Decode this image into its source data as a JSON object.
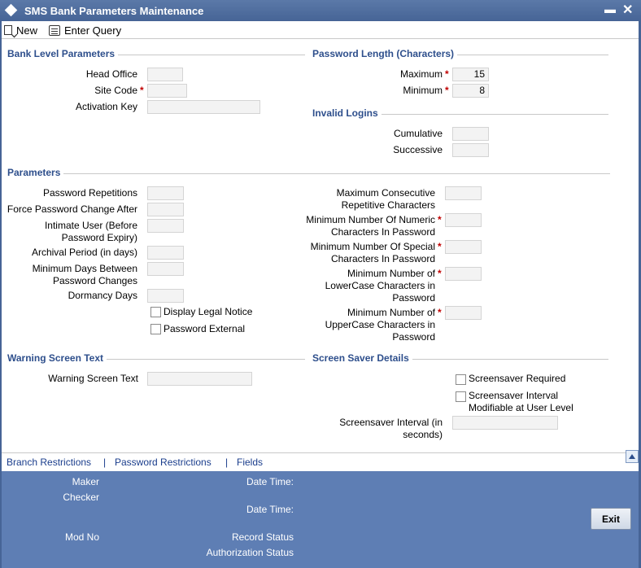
{
  "window": {
    "title": "SMS Bank Parameters Maintenance",
    "minimize_glyph": "▬",
    "close_glyph": "✕"
  },
  "toolbar": {
    "new_label": "New",
    "enter_query_label": "Enter Query"
  },
  "bank_level": {
    "title": "Bank Level Parameters",
    "head_office_label": "Head Office",
    "site_code_label": "Site Code",
    "activation_key_label": "Activation Key",
    "head_office_value": "",
    "site_code_value": "",
    "activation_key_value": ""
  },
  "password_length": {
    "title": "Password Length (Characters)",
    "maximum_label": "Maximum",
    "minimum_label": "Minimum",
    "maximum_value": "15",
    "minimum_value": "8"
  },
  "invalid_logins": {
    "title": "Invalid Logins",
    "cumulative_label": "Cumulative",
    "successive_label": "Successive",
    "cumulative_value": "",
    "successive_value": ""
  },
  "parameters": {
    "title": "Parameters",
    "password_repetitions_label": "Password Repetitions",
    "force_password_change_label": "Force Password Change After",
    "intimate_user_line1": "Intimate User (Before",
    "intimate_user_line2": "Password Expiry)",
    "archival_period_label": "Archival Period (in days)",
    "min_days_line1": "Minimum Days Between",
    "min_days_line2": "Password Changes",
    "dormancy_days_label": "Dormancy Days",
    "display_legal_notice_label": "Display Legal Notice",
    "password_external_label": "Password External",
    "max_consecutive_line1": "Maximum Consecutive",
    "max_consecutive_line2": "Repetitive Characters",
    "min_numeric_line1": "Minimum Number Of Numeric",
    "min_numeric_line2": "Characters In Password",
    "min_special_line1": "Minimum Number Of Special",
    "min_special_line2": "Characters In Password",
    "min_lower_line1": "Minimum Number of",
    "min_lower_line2": "LowerCase Characters in",
    "min_lower_line3": "Password",
    "min_upper_line1": "Minimum Number of",
    "min_upper_line2": "UpperCase Characters in",
    "min_upper_line3": "Password"
  },
  "warning_screen": {
    "title": "Warning Screen Text",
    "label": "Warning Screen Text",
    "value": ""
  },
  "screen_saver": {
    "title": "Screen Saver Details",
    "required_label": "Screensaver Required",
    "modifiable_line1": "Screensaver Interval",
    "modifiable_line2": "Modifiable at User Level",
    "interval_line1": "Screensaver Interval (in",
    "interval_line2": "seconds)",
    "interval_value": ""
  },
  "links": {
    "branch_restrictions": "Branch Restrictions",
    "password_restrictions": "Password Restrictions",
    "fields": "Fields",
    "separator": "|"
  },
  "footer": {
    "maker_label": "Maker",
    "checker_label": "Checker",
    "date_time_label": "Date Time:",
    "mod_no_label": "Mod No",
    "record_status_label": "Record Status",
    "authorization_status_label": "Authorization Status",
    "exit_label": "Exit"
  },
  "colors": {
    "titlebar": "#466496",
    "section_title": "#2e4f8c",
    "footer": "#5e7eb4",
    "required": "#c00000",
    "link": "#1a3d8c"
  }
}
